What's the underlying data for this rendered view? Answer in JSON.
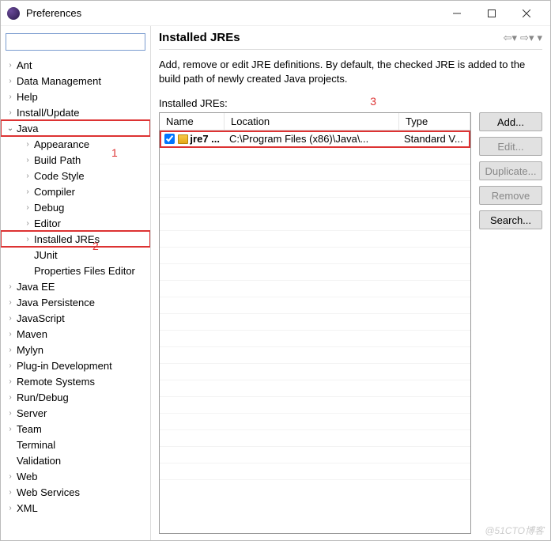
{
  "window": {
    "title": "Preferences"
  },
  "filter": {
    "placeholder": ""
  },
  "tree": {
    "items": [
      {
        "label": "Ant",
        "expandable": true
      },
      {
        "label": "Data Management",
        "expandable": true
      },
      {
        "label": "Help",
        "expandable": true
      },
      {
        "label": "Install/Update",
        "expandable": true
      },
      {
        "label": "Java",
        "expandable": true,
        "expanded": true,
        "highlight": true,
        "children": [
          {
            "label": "Appearance",
            "expandable": true
          },
          {
            "label": "Build Path",
            "expandable": true
          },
          {
            "label": "Code Style",
            "expandable": true
          },
          {
            "label": "Compiler",
            "expandable": true
          },
          {
            "label": "Debug",
            "expandable": true
          },
          {
            "label": "Editor",
            "expandable": true
          },
          {
            "label": "Installed JREs",
            "expandable": true,
            "highlight": true
          },
          {
            "label": "JUnit",
            "expandable": false
          },
          {
            "label": "Properties Files Editor",
            "expandable": false
          }
        ]
      },
      {
        "label": "Java EE",
        "expandable": true
      },
      {
        "label": "Java Persistence",
        "expandable": true
      },
      {
        "label": "JavaScript",
        "expandable": true
      },
      {
        "label": "Maven",
        "expandable": true
      },
      {
        "label": "Mylyn",
        "expandable": true
      },
      {
        "label": "Plug-in Development",
        "expandable": true
      },
      {
        "label": "Remote Systems",
        "expandable": true
      },
      {
        "label": "Run/Debug",
        "expandable": true
      },
      {
        "label": "Server",
        "expandable": true
      },
      {
        "label": "Team",
        "expandable": true
      },
      {
        "label": "Terminal",
        "expandable": false
      },
      {
        "label": "Validation",
        "expandable": false
      },
      {
        "label": "Web",
        "expandable": true
      },
      {
        "label": "Web Services",
        "expandable": true
      },
      {
        "label": "XML",
        "expandable": true
      }
    ]
  },
  "page": {
    "heading": "Installed JREs",
    "description": "Add, remove or edit JRE definitions. By default, the checked JRE is added to the build path of newly created Java projects.",
    "list_label": "Installed JREs:",
    "columns": {
      "name": "Name",
      "location": "Location",
      "type": "Type"
    },
    "rows": [
      {
        "checked": true,
        "name": "jre7 ...",
        "location": "C:\\Program Files (x86)\\Java\\...",
        "type": "Standard V..."
      }
    ],
    "buttons": {
      "add": "Add...",
      "edit": "Edit...",
      "duplicate": "Duplicate...",
      "remove": "Remove",
      "search": "Search..."
    }
  },
  "annotations": {
    "a1": "1",
    "a2": "2",
    "a3": "3"
  },
  "watermark": "@51CTO博客"
}
